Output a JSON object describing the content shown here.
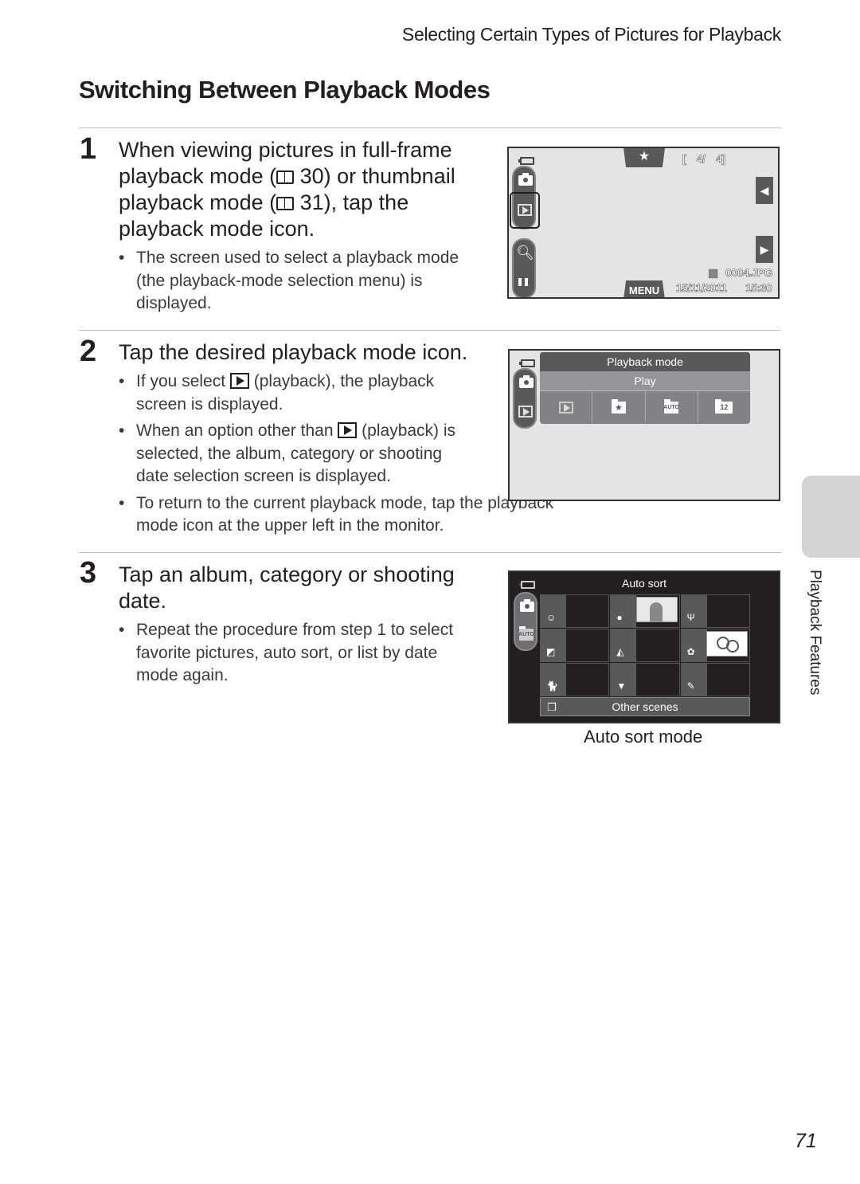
{
  "running_head": "Selecting Certain Types of Pictures for Playback",
  "page_title": "Switching Between Playback Modes",
  "steps": [
    {
      "number": "1",
      "heading_lines": [
        "When viewing pictures in full-frame",
        "playback mode (",
        " 30) or thumbnail",
        "playback mode (",
        " 31), tap the",
        "playback mode icon."
      ],
      "bullets": [
        "The screen used to select a playback mode (the playback-mode selection menu) is displayed."
      ]
    },
    {
      "number": "2",
      "heading": "Tap the desired playback mode icon.",
      "bullets": [
        {
          "before": "If you select ",
          "after": " (playback), the playback screen is displayed."
        },
        {
          "before": "When an option other than ",
          "after": " (playback) is selected, the album, category or shooting date selection screen is displayed."
        },
        {
          "before": "To return to the current playback mode, tap the playback mode icon at the upper left in the monitor.",
          "after": ""
        }
      ]
    },
    {
      "number": "3",
      "heading": "Tap an album, category or shooting date.",
      "bullets": [
        "Repeat the procedure from step 1 to select favorite pictures, auto sort, or list by date mode again."
      ]
    }
  ],
  "bullet_char": "•",
  "screen1": {
    "favorite_icon": "★",
    "counter": "[    4/    4]",
    "prev_icon": "◀",
    "next_icon": "▶",
    "menu_label": "MENU",
    "file_name": "0004.JPG",
    "date": "15/11/2011",
    "time": "15:30",
    "left_icons": [
      "camera-icon",
      "playback-icon",
      "zoom-icon",
      "thumbnail-icon"
    ]
  },
  "screen2": {
    "menu_title": "Playback mode",
    "selected_option": "Play",
    "options": [
      {
        "name": "play",
        "glyph": ""
      },
      {
        "name": "favorite-pictures",
        "glyph": "★"
      },
      {
        "name": "auto-sort",
        "glyph": "AUTO"
      },
      {
        "name": "list-by-date",
        "glyph": "12"
      }
    ]
  },
  "screen3": {
    "title": "Auto sort",
    "mode_badge": "AUTO",
    "categories": [
      {
        "name": "smile",
        "glyph": "☺"
      },
      {
        "name": "portraits",
        "glyph": "●"
      },
      {
        "name": "food",
        "glyph": "Ψ"
      },
      {
        "name": "landscape",
        "glyph": "◩"
      },
      {
        "name": "dusk-to-dawn",
        "glyph": "◭"
      },
      {
        "name": "close-ups",
        "glyph": "✿"
      },
      {
        "name": "pet-portrait",
        "glyph": "🐈"
      },
      {
        "name": "movie",
        "glyph": "▼"
      },
      {
        "name": "retouched-copies",
        "glyph": "✎"
      }
    ],
    "other_scenes": "Other scenes",
    "other_icon": "❐"
  },
  "caption": "Auto sort mode",
  "side_tab_label": "Playback Features",
  "page_number": "71"
}
